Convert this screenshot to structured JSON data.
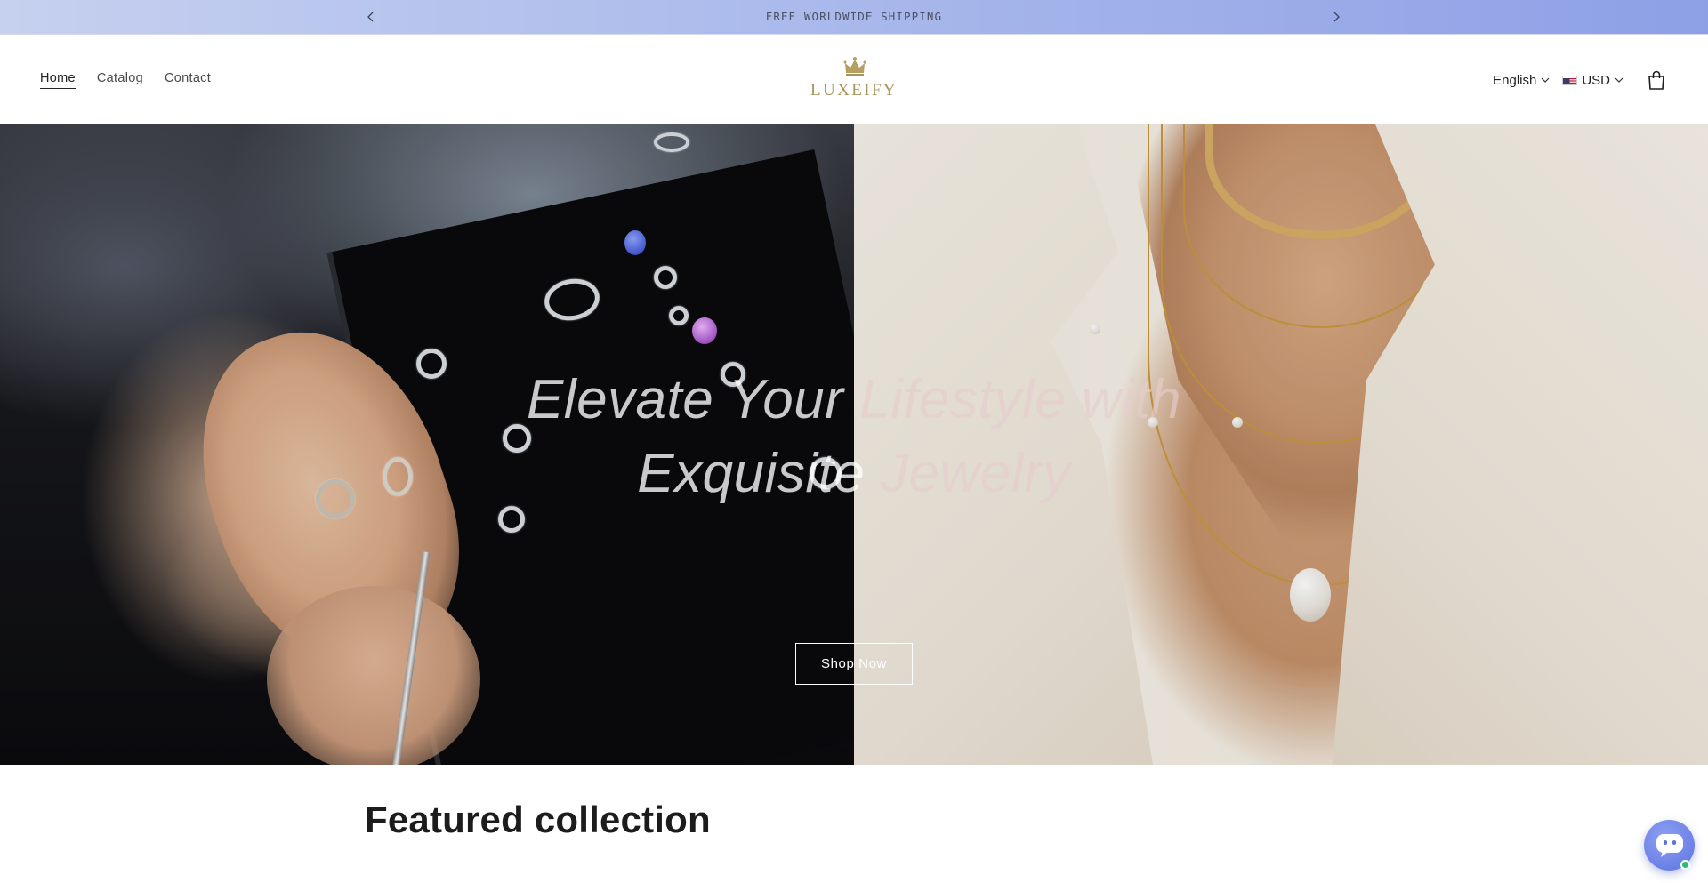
{
  "announcement": {
    "text": "FREE WORLDWIDE SHIPPING",
    "prev_icon": "chevron-left-icon",
    "next_icon": "chevron-right-icon"
  },
  "header": {
    "nav": [
      {
        "label": "Home",
        "active": true
      },
      {
        "label": "Catalog",
        "active": false
      },
      {
        "label": "Contact",
        "active": false
      }
    ],
    "logo_text": "LUXEIFY",
    "logo_icon": "crown-icon",
    "language": "English",
    "currency": "USD",
    "currency_flag": "us-flag-icon",
    "cart_icon": "shopping-bag-icon"
  },
  "hero": {
    "title_line1_a": "Elevate Your ",
    "title_line1_b": "Lifestyle with",
    "title_line2_a": "Exquisite ",
    "title_line2_b": "Jewelry",
    "button_label": "Shop Now"
  },
  "featured": {
    "title": "Featured collection"
  },
  "chat": {
    "icon": "chat-bot-icon",
    "status_color": "#25c16f"
  },
  "colors": {
    "announcement_bar": "#8da0e6",
    "logo_gold": "#a8935a",
    "chat_accent": "#5d73e0"
  }
}
